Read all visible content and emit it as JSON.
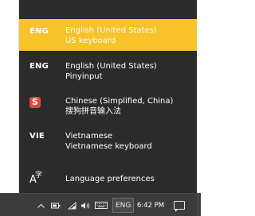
{
  "flyout": {
    "items": [
      {
        "code": "ENG",
        "line1": "English (United States)",
        "line2": "US keyboard",
        "selected": true
      },
      {
        "code": "ENG",
        "line1": "English (United States)",
        "line2": "Pinyinput",
        "selected": false
      },
      {
        "code": "S",
        "line1": "Chinese (Simplified, China)",
        "line2": "搜狗拼音输入法",
        "selected": false
      },
      {
        "code": "VIE",
        "line1": "Vietnamese",
        "line2": "Vietnamese keyboard",
        "selected": false
      }
    ],
    "preferences_label": "Language preferences",
    "preferences_icon": "language-settings-icon"
  },
  "taskbar": {
    "input_indicator": "ENG",
    "time": "6:42 PM",
    "icons": [
      "chevron-up-icon",
      "battery-icon",
      "wifi-icon",
      "volume-icon",
      "touch-keyboard-icon",
      "action-center-icon"
    ]
  },
  "colors": {
    "flyout_bg": "#2b2b2b",
    "selected_bg": "#f7c22a",
    "taskbar_bg": "#3b3b3b",
    "sogou_brand": "#e8453c"
  }
}
